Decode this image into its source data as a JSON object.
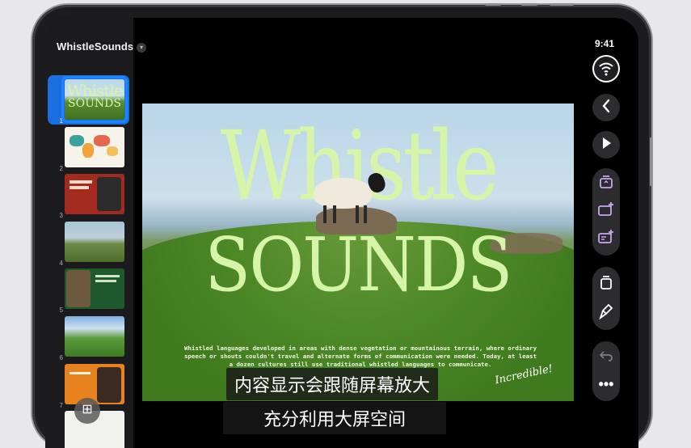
{
  "app": {
    "name": "WhistleSounds"
  },
  "status": {
    "time": "9:41"
  },
  "slides": [
    {
      "number": "1",
      "label": "Whistle SOUNDS",
      "selected": true
    },
    {
      "number": "2",
      "label": "map slide"
    },
    {
      "number": "3",
      "label": "red slide"
    },
    {
      "number": "4",
      "label": "landscape slide"
    },
    {
      "number": "5",
      "label": "green slide"
    },
    {
      "number": "6",
      "label": "mountain slide"
    },
    {
      "number": "7",
      "label": "orange slide"
    }
  ],
  "slide": {
    "title_line1": "Whistle",
    "title_line2": "SOUNDS",
    "body": "Whistled languages developed in areas with dense vegetation or mountainous terrain, where ordinary speech or shouts couldn't travel and alternate forms of communication were needed. Today, at least a dozen cultures still use traditional whistled languages to communicate.",
    "handwriting": "Incredible!"
  },
  "subtitles": {
    "line1": "内容显示会跟随屏幕放大",
    "line2": "充分利用大屏空间"
  },
  "toolbar": {
    "icons": [
      "wifi-icon",
      "back-icon",
      "play-icon",
      "add-text-icon",
      "add-shape-icon",
      "add-media-icon",
      "layers-icon",
      "format-brush-icon",
      "undo-icon",
      "more-icon"
    ]
  },
  "colors": {
    "accent": "#1a86ff",
    "toolbar_icon": "#c9a7f2",
    "title_green": "#d7f5a8"
  }
}
